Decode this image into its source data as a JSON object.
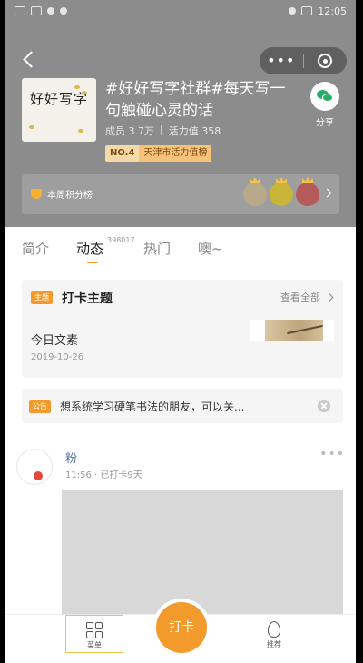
{
  "status_bar": {
    "time": "12:05"
  },
  "header": {
    "group_title": "#好好写字社群#每天写一句触碰心灵的话",
    "cover_title": "好好写字",
    "members": "成员 3.7万",
    "activity": "活力值 358",
    "rank_no": "NO.4",
    "rank_text": "天津市活力值榜",
    "share_label": "分享",
    "points_label": "本周积分榜"
  },
  "tabs": [
    {
      "label": "简介"
    },
    {
      "label": "动态",
      "count": "398017"
    },
    {
      "label": "热门"
    },
    {
      "label": "噢~"
    }
  ],
  "checkin": {
    "tag": "主题",
    "title": "打卡主题",
    "see_all": "查看全部",
    "daily_title": "今日文素",
    "daily_date": "2019-10-26"
  },
  "notice": {
    "tag": "公告",
    "text": "想系统学习硬笔书法的朋友，可以关..."
  },
  "post": {
    "author": "粉",
    "meta": "11:56 · 已打卡9天"
  },
  "bottom_bar": {
    "menu_label": "菜单",
    "checkin_label": "打卡",
    "recommend_label": "推荐"
  },
  "colors": {
    "accent": "#f39a2d",
    "header_bg": "#8c8c8c",
    "wechat_green": "#2aae67"
  }
}
